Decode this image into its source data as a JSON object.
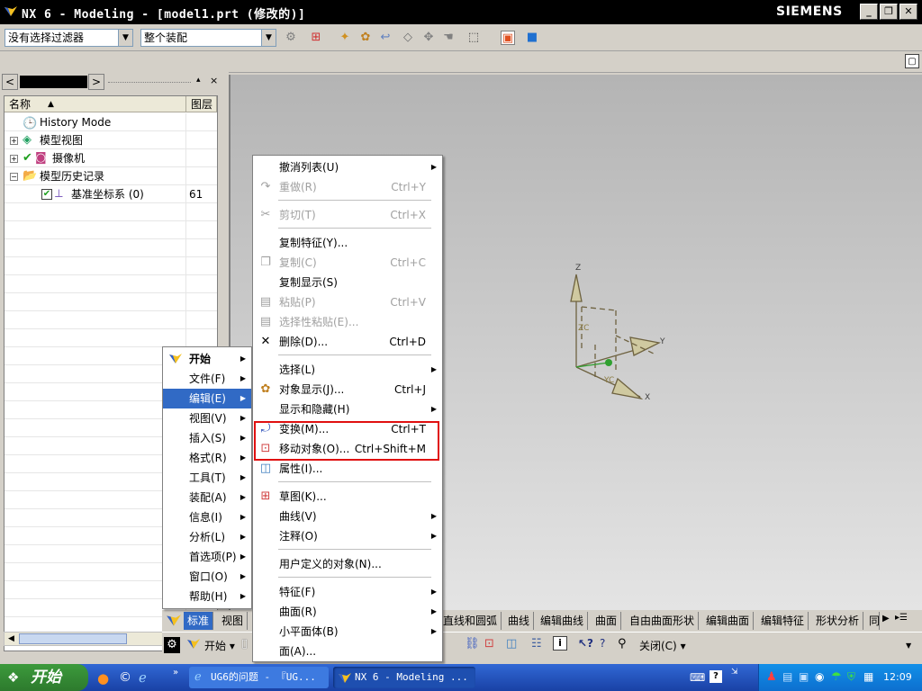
{
  "window": {
    "title": "NX 6 - Modeling - [model1.prt (修改的)]",
    "brand": "SIEMENS",
    "minimize": "_",
    "restore": "❐",
    "close": "✕"
  },
  "toolbar": {
    "filter_value": "没有选择过滤器",
    "scope_value": "整个装配"
  },
  "navigator": {
    "columns": [
      "名称",
      "图层"
    ],
    "rows": [
      {
        "label": "History Mode",
        "layer": ""
      },
      {
        "label": "模型视图",
        "layer": ""
      },
      {
        "label": "摄像机",
        "layer": ""
      },
      {
        "label": "模型历史记录",
        "layer": ""
      },
      {
        "label": "基准坐标系 (0)",
        "layer": "61"
      }
    ]
  },
  "coord_labels": {
    "z": "Z",
    "zc": "ZC",
    "y": "Y",
    "yc": "YC",
    "x": "X"
  },
  "main_menu": {
    "items": [
      {
        "label": "开始"
      },
      {
        "label": "文件(F)"
      },
      {
        "label": "编辑(E)"
      },
      {
        "label": "视图(V)"
      },
      {
        "label": "插入(S)"
      },
      {
        "label": "格式(R)"
      },
      {
        "label": "工具(T)"
      },
      {
        "label": "装配(A)"
      },
      {
        "label": "信息(I)"
      },
      {
        "label": "分析(L)"
      },
      {
        "label": "首选项(P)"
      },
      {
        "label": "窗口(O)"
      },
      {
        "label": "帮助(H)"
      }
    ]
  },
  "edit_menu": {
    "items": [
      {
        "label": "撤消列表(U)",
        "shortcut": ""
      },
      {
        "label": "重做(R)",
        "shortcut": "Ctrl+Y"
      },
      {
        "label": "剪切(T)",
        "shortcut": "Ctrl+X"
      },
      {
        "label": "复制特征(Y)...",
        "shortcut": ""
      },
      {
        "label": "复制(C)",
        "shortcut": "Ctrl+C"
      },
      {
        "label": "复制显示(S)",
        "shortcut": ""
      },
      {
        "label": "粘贴(P)",
        "shortcut": "Ctrl+V"
      },
      {
        "label": "选择性粘贴(E)...",
        "shortcut": ""
      },
      {
        "label": "删除(D)...",
        "shortcut": "Ctrl+D"
      },
      {
        "label": "选择(L)",
        "shortcut": ""
      },
      {
        "label": "对象显示(J)...",
        "shortcut": "Ctrl+J"
      },
      {
        "label": "显示和隐藏(H)",
        "shortcut": ""
      },
      {
        "label": "变换(M)...",
        "shortcut": "Ctrl+T"
      },
      {
        "label": "移动对象(O)...",
        "shortcut": "Ctrl+Shift+M"
      },
      {
        "label": "属性(I)...",
        "shortcut": ""
      },
      {
        "label": "草图(K)...",
        "shortcut": ""
      },
      {
        "label": "曲线(V)",
        "shortcut": ""
      },
      {
        "label": "注释(O)",
        "shortcut": ""
      },
      {
        "label": "用户定义的对象(N)...",
        "shortcut": ""
      },
      {
        "label": "特征(F)",
        "shortcut": ""
      },
      {
        "label": "曲面(R)",
        "shortcut": ""
      },
      {
        "label": "小平面体(B)",
        "shortcut": ""
      },
      {
        "label": "面(A)...",
        "shortcut": ""
      }
    ]
  },
  "tabs": [
    "标准",
    "视图",
    "直线和圆弧",
    "曲线",
    "编辑曲线",
    "曲面",
    "自由曲面形状",
    "编辑曲面",
    "编辑特征",
    "形状分析",
    "同"
  ],
  "bottom_toolbar": {
    "start": "开始",
    "close": "关闭(C)"
  },
  "taskbar": {
    "start": "开始",
    "tasks": [
      "UG6的问题 - 『UG...",
      "NX 6 - Modeling ..."
    ],
    "clock": "12:09"
  }
}
